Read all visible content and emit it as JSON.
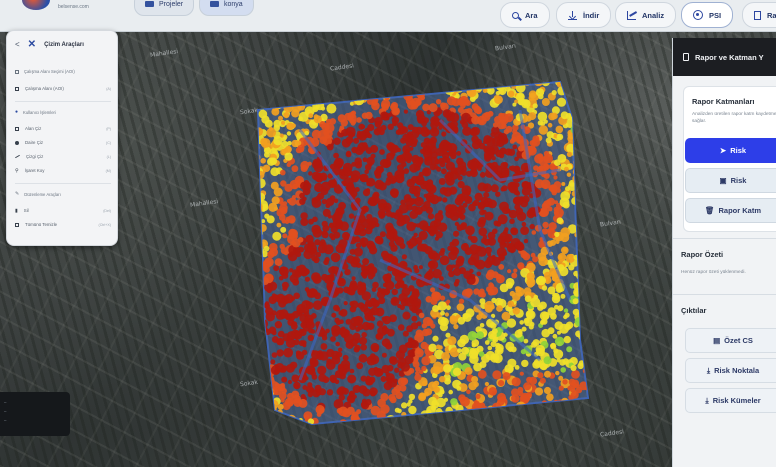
{
  "header": {
    "logo_text": "belsense.com",
    "nav": [
      {
        "label": "Projeler",
        "icon": "folder-icon"
      },
      {
        "label": "konya",
        "icon": "folder-icon"
      }
    ],
    "tools": [
      {
        "label": "Ara",
        "icon": "search-icon"
      },
      {
        "label": "İndir",
        "icon": "download-icon"
      },
      {
        "label": "Analiz",
        "icon": "chart-icon"
      },
      {
        "label": "PSI",
        "icon": "psi-icon"
      },
      {
        "label": "Ra",
        "icon": "document-icon"
      }
    ]
  },
  "left_panel": {
    "back": "<",
    "icon": "tools-icon",
    "title": "Çizim Araçları",
    "area_section": "Çalışma Alanı Seçimi (AOI)",
    "area_item": "Çalışma Alanı (AOI)",
    "drawing_section": "Kullanıcı İşlemleri",
    "items": [
      {
        "label": "Alan Çiz",
        "key": "",
        "icon": "polygon-icon"
      },
      {
        "label": "Daire Çiz",
        "key": "",
        "icon": "circle-icon"
      },
      {
        "label": "Çizgi Çiz",
        "key": "",
        "icon": "line-icon"
      },
      {
        "label": "İşaret Koy",
        "key": "",
        "icon": "marker-icon"
      }
    ],
    "edit_section": "Düzenleme Araçları",
    "edit_items": [
      {
        "label": "Sil",
        "key": ""
      },
      {
        "label": "Tümünü Temizle",
        "key": ""
      }
    ]
  },
  "map_labels": [
    "Mahallesi",
    "Caddesi",
    "Sokak",
    "Bulvarı"
  ],
  "readout": [
    "—",
    "—",
    "—"
  ],
  "right_panel": {
    "title": "Rapor ve Katman Y",
    "layers_title": "Rapor Katmanları",
    "layers_desc": "Analizden üretilen rapor katm kaydetmenizi sağlar.",
    "btn_primary": "Risk",
    "btn_secondary": "Risk",
    "btn_delete": "Rapor Katm",
    "summary_title": "Rapor Özeti",
    "summary_note": "Henüz rapor özeti yüklenmedi.",
    "outputs_title": "Çıktılar",
    "outputs": [
      "Özet CS",
      "Risk Noktala",
      "Risk Kümeler"
    ]
  },
  "heatmap_colors": {
    "high": "#b0180e",
    "mid_high": "#e2501f",
    "mid": "#f2a020",
    "low": "#f0e02a",
    "lowest": "#8fd23a",
    "boundary": "#3d67c8"
  }
}
